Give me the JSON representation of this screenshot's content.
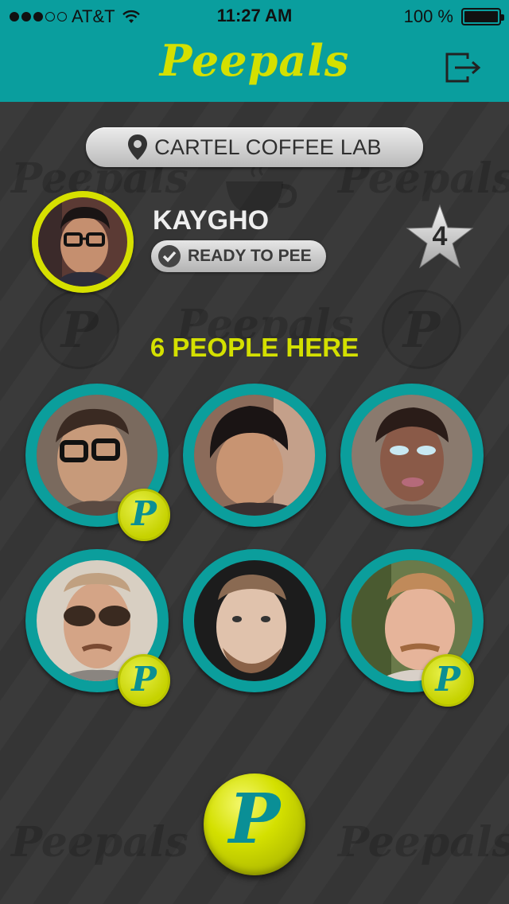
{
  "status_bar": {
    "carrier": "AT&T",
    "time": "11:27 AM",
    "battery": "100 %"
  },
  "header": {
    "app_title": "Peepals",
    "logout_icon": "logout-icon"
  },
  "colors": {
    "teal": "#0a9e9e",
    "yellow": "#d4e000",
    "background": "#3a3a3a"
  },
  "location": {
    "name": "CARTEL COFFEE LAB",
    "icon": "map-pin-icon"
  },
  "me": {
    "username": "KAYGHO",
    "status": "READY TO PEE",
    "rating": "4"
  },
  "people_here_label": "6 PEOPLE HERE",
  "people": [
    {
      "badge": "P"
    },
    {
      "badge": ""
    },
    {
      "badge": ""
    },
    {
      "badge": "P"
    },
    {
      "badge": ""
    },
    {
      "badge": "P"
    }
  ],
  "big_button_label": "P",
  "watermark_text": "Peepals"
}
